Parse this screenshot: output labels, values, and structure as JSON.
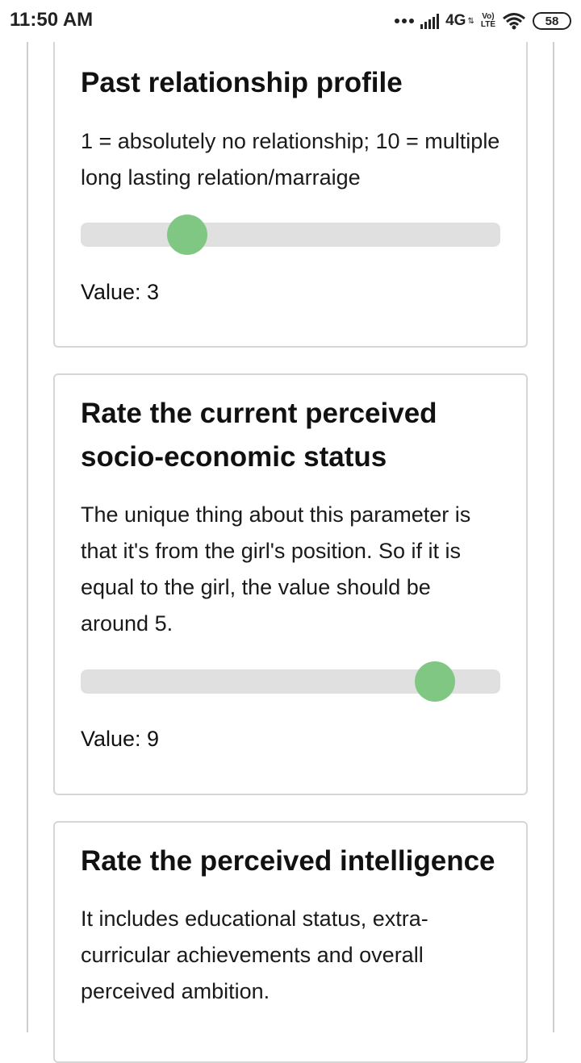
{
  "status_bar": {
    "time": "11:50 AM",
    "network": "4G",
    "volte": "Vo) LTE",
    "battery": "58"
  },
  "cards": [
    {
      "title": "Past relationship profile",
      "description": "1 = absolutely no relationship; 10 = multiple long lasting relation/marraige",
      "slider": {
        "min": 1,
        "max": 10,
        "value": 3
      },
      "value_label": "Value: 3"
    },
    {
      "title": "Rate the current perceived socio-economic status",
      "description": "The unique thing about this parameter is that it's from the girl's position. So if it is equal to the girl, the value should be around 5.",
      "slider": {
        "min": 1,
        "max": 10,
        "value": 9
      },
      "value_label": "Value: 9"
    },
    {
      "title": "Rate the perceived intelligence",
      "description": "It includes educational status, extra-curricular achievements and overall perceived ambition."
    }
  ],
  "colors": {
    "thumb": "#81c784",
    "track": "#e0e0e0",
    "card_border": "#d6d6d6"
  },
  "icons": [
    "more-dots-icon",
    "signal-icon",
    "wifi-icon",
    "battery-icon"
  ]
}
